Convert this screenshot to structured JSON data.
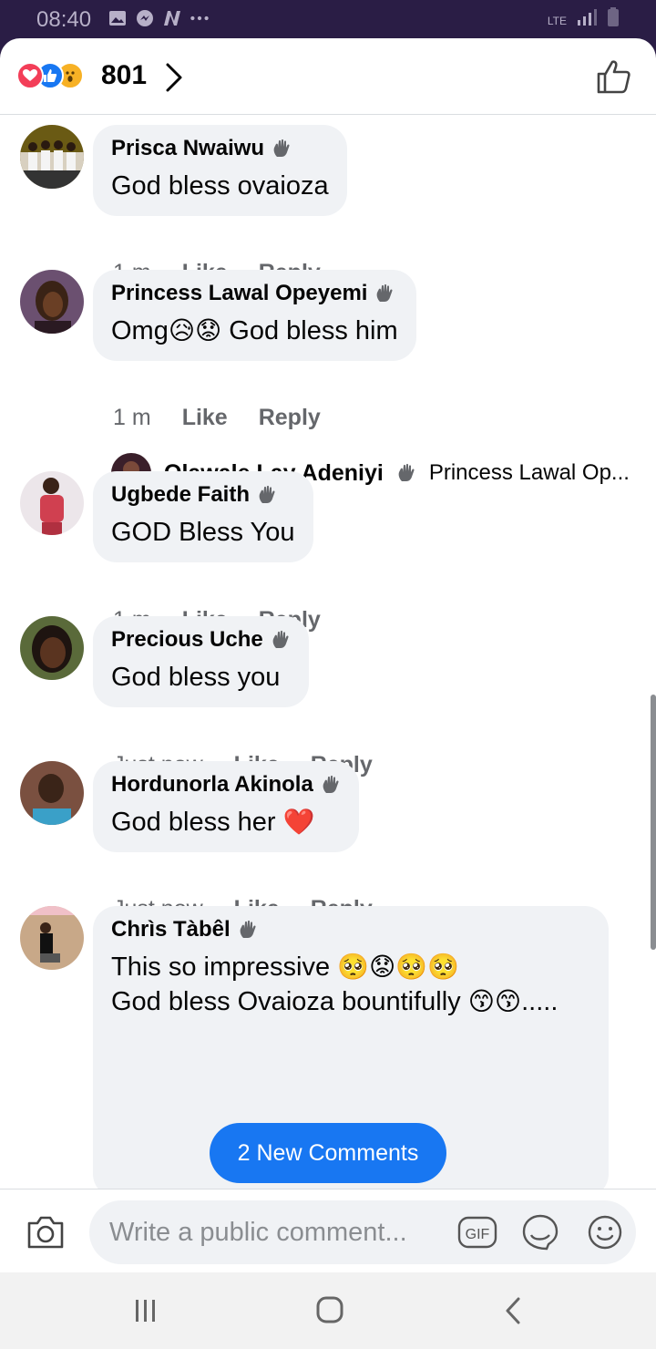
{
  "status_bar": {
    "time": "08:40",
    "network": "LTE"
  },
  "header": {
    "reaction_count": "801"
  },
  "comments": [
    {
      "author": "Prisca Nwaiwu",
      "text": "God bless ovaioza",
      "time": "1 m",
      "like": "Like",
      "reply": "Reply"
    },
    {
      "author": "Princess Lawal Opeyemi",
      "text": "Omg",
      "text_emoji": "😥😟",
      "text_after": " God bless him",
      "time": "1 m",
      "like": "Like",
      "reply": "Reply"
    },
    {
      "author": "Ugbede Faith",
      "text": "GOD Bless You",
      "time": "1 m",
      "like": "Like",
      "reply": "Reply"
    },
    {
      "author": "Precious Uche",
      "text": "God bless you",
      "time": "Just now",
      "like": "Like",
      "reply": "Reply"
    },
    {
      "author": "Hordunorla Akinola",
      "text": "God bless her ",
      "text_emoji": "❤️",
      "time": "Just now",
      "like": "Like",
      "reply": "Reply"
    },
    {
      "author": "Chrìs Tàbêl",
      "line1": "This so impressive ",
      "line1_emoji": "🥺😟🥺🥺",
      "line2": "God bless Ovaioza bountifully ",
      "line2_emoji": "😙😙",
      "line2_tail": "....."
    }
  ],
  "reply_preview": {
    "author": "Olawale Lay Adeniyi",
    "text": "Princess Lawal Op..."
  },
  "new_comments_button": "2 New Comments",
  "composer": {
    "placeholder": "Write a public comment...",
    "gif_label": "GIF"
  },
  "colors": {
    "accent": "#1877f2",
    "bubble": "#f0f2f5",
    "status_bar": "#2a1d45"
  }
}
